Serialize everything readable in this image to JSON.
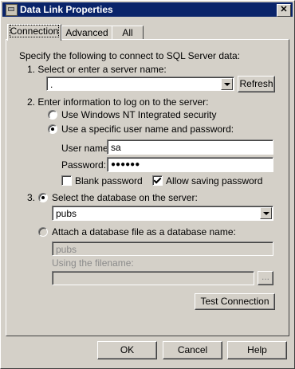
{
  "window": {
    "title": "Data Link Properties",
    "close_glyph": "✕"
  },
  "tabs": [
    {
      "label": "Connection",
      "active": true
    },
    {
      "label": "Advanced",
      "active": false
    },
    {
      "label": "All",
      "active": false
    }
  ],
  "intro": "Specify the following to connect to SQL Server data:",
  "step1": {
    "label": "1. Select or enter a server name:",
    "server_value": ".",
    "refresh_label": "Refresh"
  },
  "step2": {
    "label": "2. Enter information to log on to the server:",
    "nt_security_label": "Use Windows NT Integrated security",
    "nt_security_selected": false,
    "specific_user_label": "Use a specific user name and password:",
    "specific_user_selected": true,
    "username_label": "User name:",
    "username_value": "sa",
    "password_label": "Password:",
    "password_value": "●●●●●●",
    "blank_password_label": "Blank password",
    "blank_password_checked": false,
    "allow_saving_label": "Allow saving password",
    "allow_saving_checked": true
  },
  "step3": {
    "number": "3.",
    "select_db_label": "Select the database on the server:",
    "select_db_selected": true,
    "database_value": "pubs",
    "attach_label": "Attach a database file as a database name:",
    "attach_selected": false,
    "attach_name_value": "pubs",
    "filename_label": "Using the filename:",
    "filename_value": "",
    "browse_label": "...",
    "test_connection_label": "Test Connection"
  },
  "footer": {
    "ok_label": "OK",
    "cancel_label": "Cancel",
    "help_label": "Help"
  },
  "colors": {
    "titlebar": "#0a246a",
    "face": "#d4d0c8",
    "disabled_text": "#8a8a8a"
  }
}
